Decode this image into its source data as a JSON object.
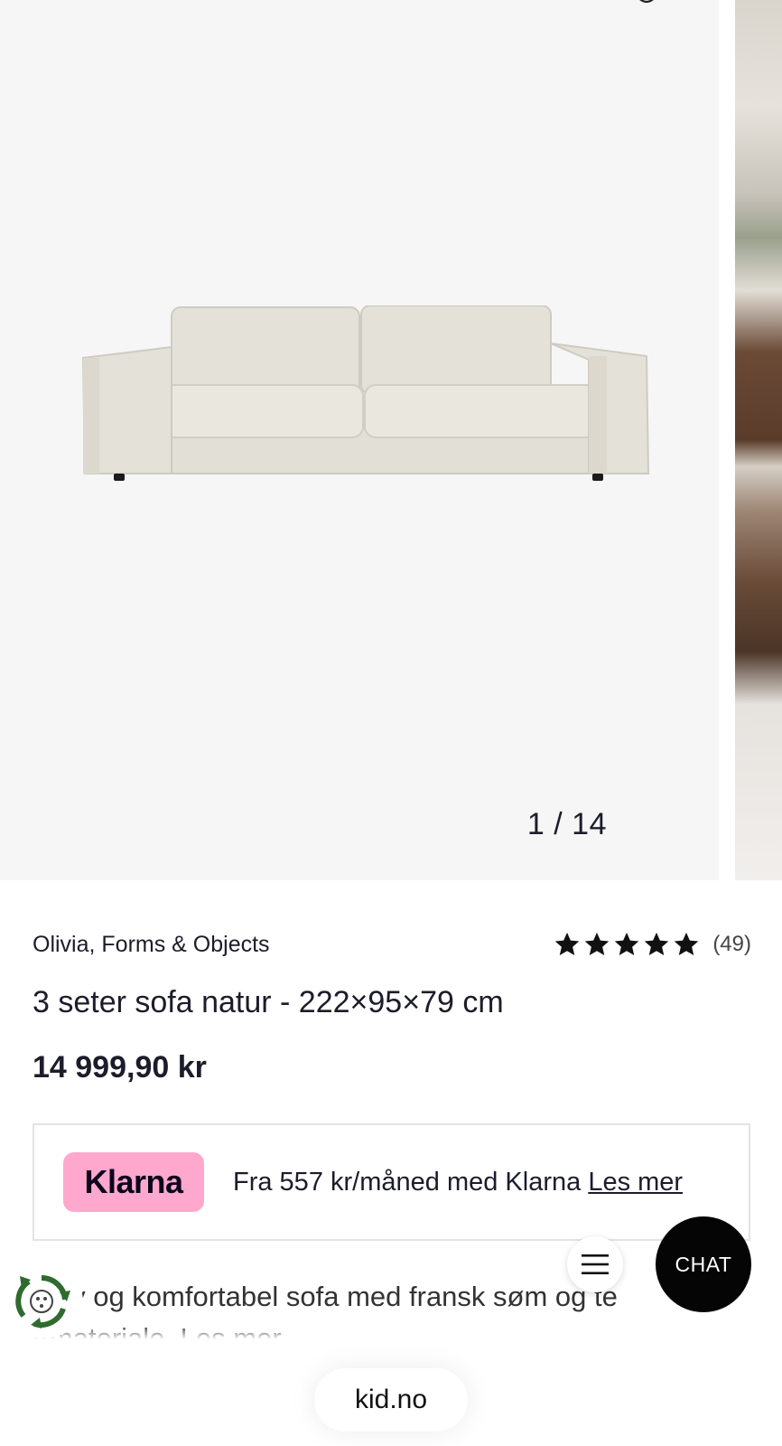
{
  "gallery": {
    "counter": "1 / 14",
    "current": 1,
    "total": 14
  },
  "product": {
    "brand": "Olivia, Forms & Objects",
    "rating_stars": 5,
    "review_count": "(49)",
    "title": "3 seter sofa natur - 222×95×79 cm",
    "price": "14 999,90 kr"
  },
  "klarna": {
    "badge": "Klarna",
    "text": "Fra 557 kr/måned med Klarna",
    "link": "Les mer"
  },
  "description": {
    "line1": "ındy og komfortabel sofa med fransk søm og te",
    "line2": "ırmateriale. Les mer"
  },
  "buttons": {
    "chat": "CHAT"
  },
  "browser": {
    "url": "kid.no"
  },
  "colors": {
    "klarna_pink": "#ffa8cd",
    "chat_black": "#050505",
    "recycle_green": "#2f6b2f"
  }
}
